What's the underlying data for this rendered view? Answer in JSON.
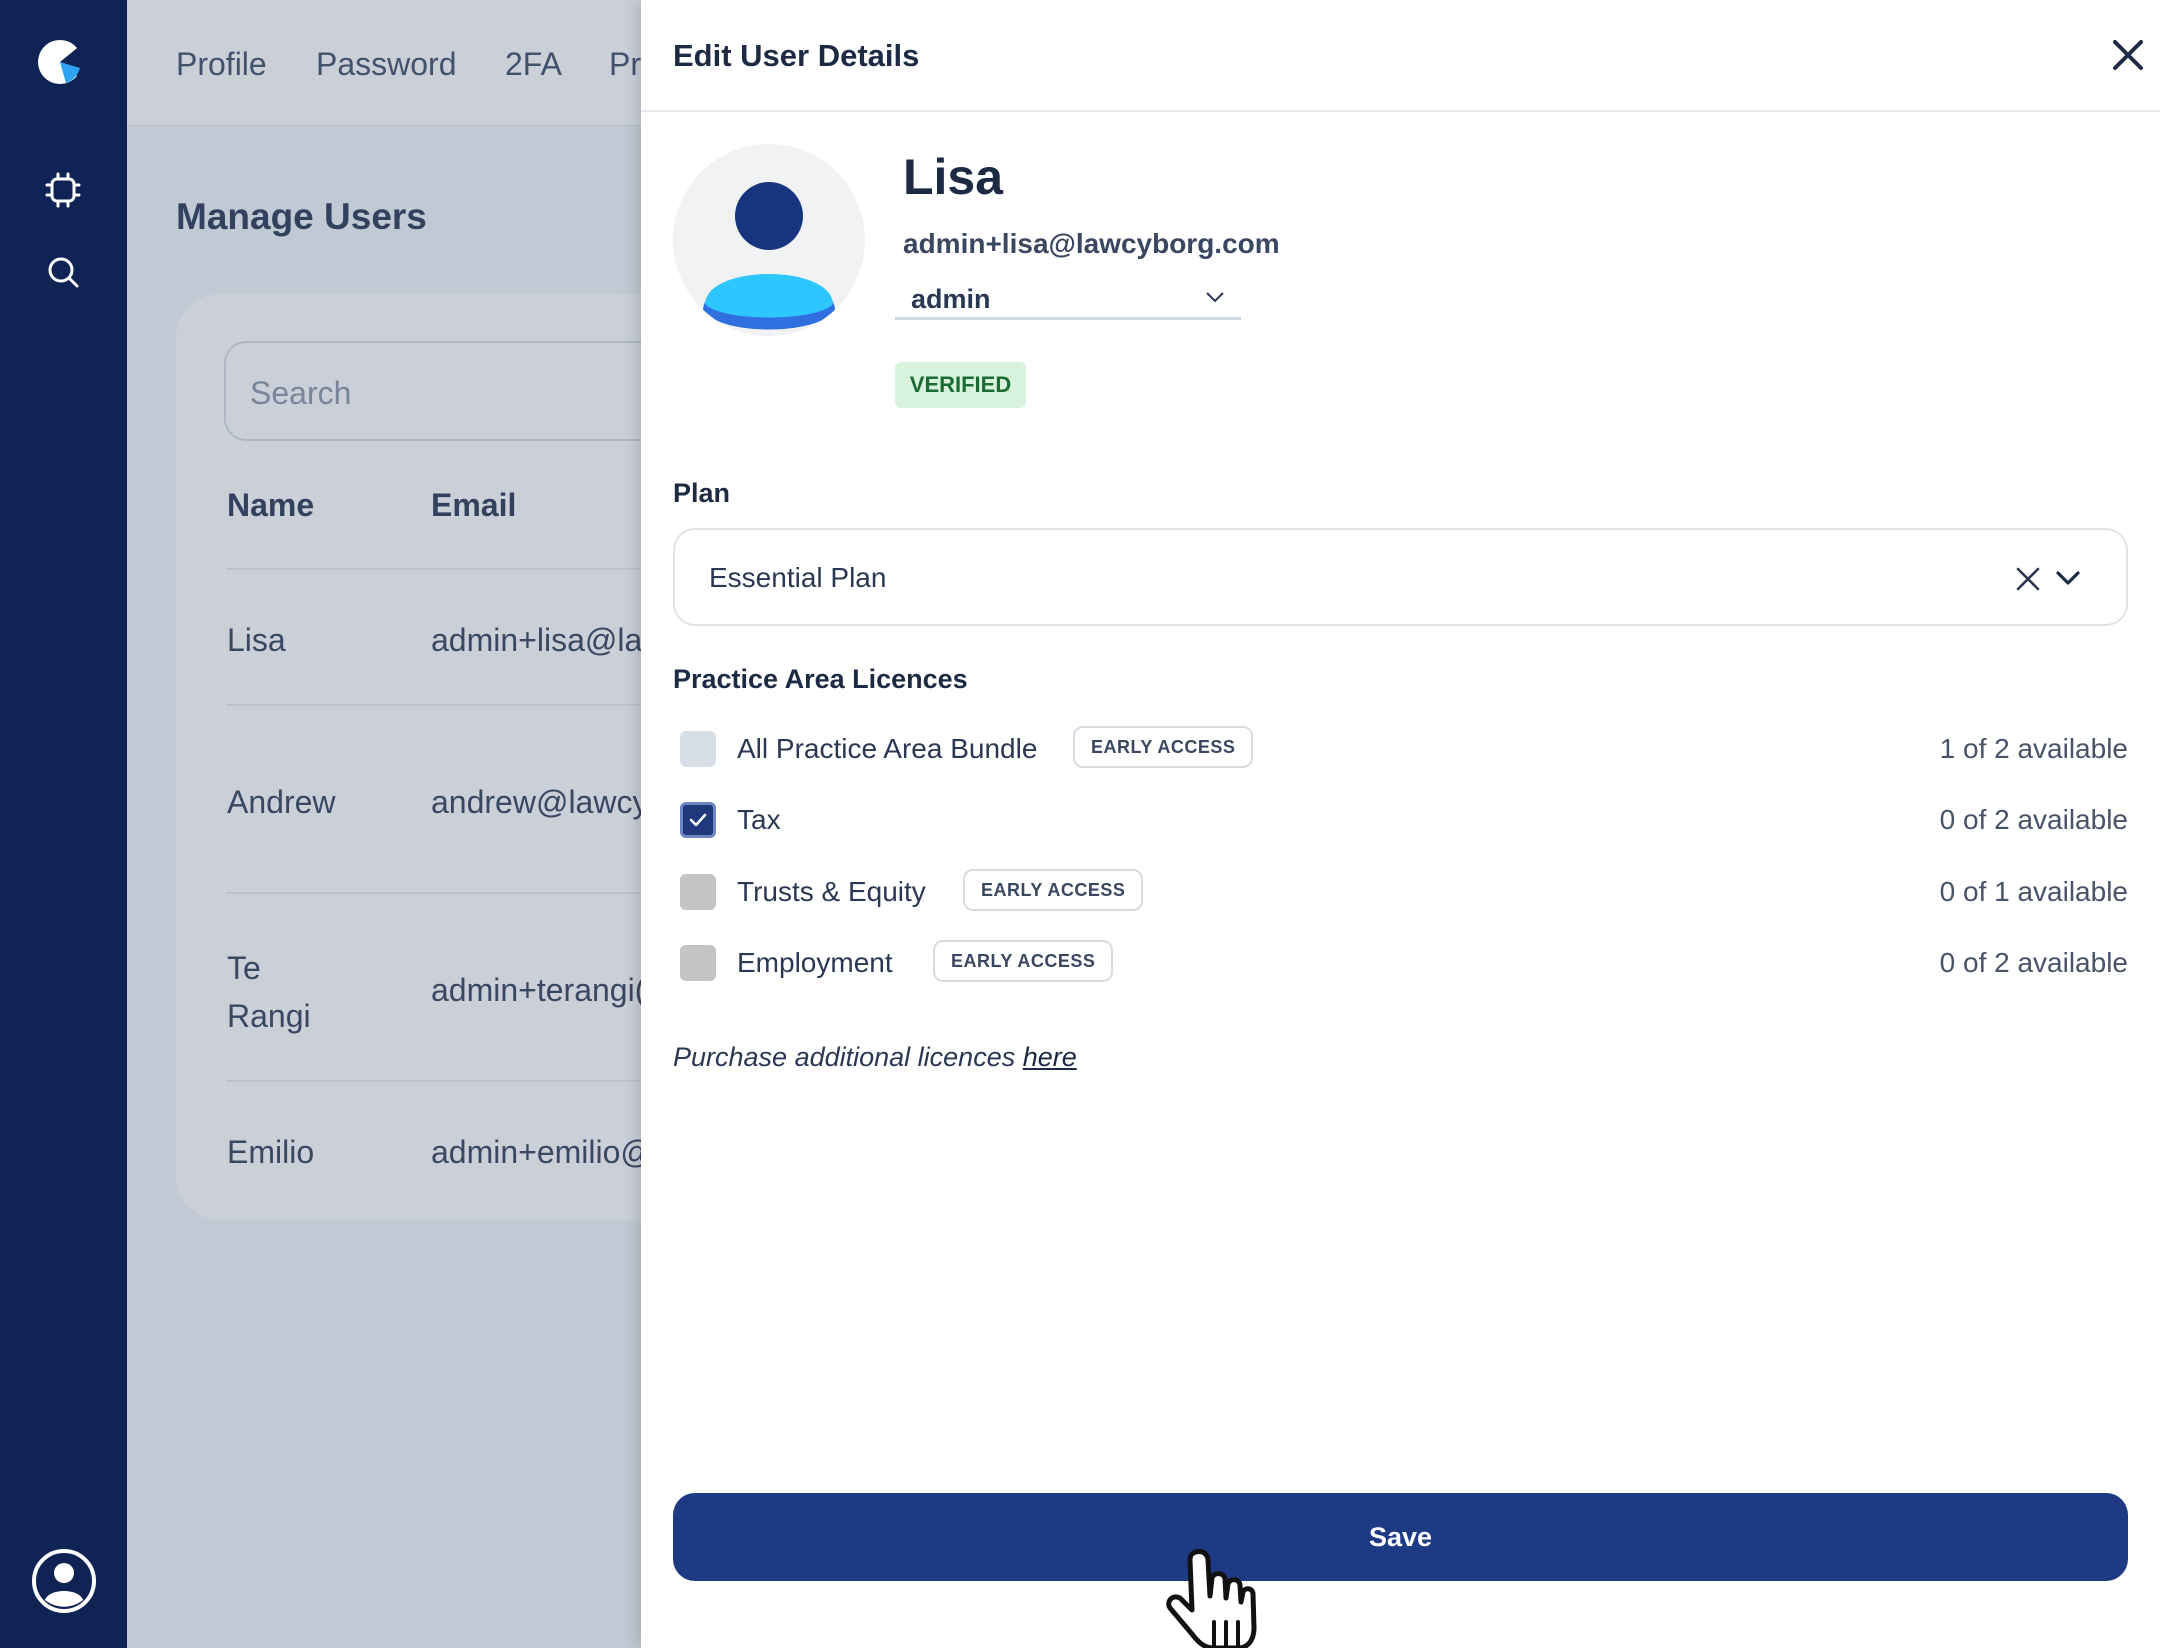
{
  "rail": {
    "icons": [
      "app-logo",
      "chip-icon",
      "search-icon",
      "account-icon"
    ],
    "colors": {
      "background": "#0f2454",
      "logo_accent": "#2ea3f2"
    }
  },
  "topnav": {
    "tabs": [
      "Profile",
      "Password",
      "2FA",
      "Pr"
    ]
  },
  "manage_users": {
    "title": "Manage Users",
    "search_placeholder": "Search",
    "columns": [
      "Name",
      "Email"
    ],
    "rows": [
      {
        "name": "Lisa",
        "email": "admin+lisa@la"
      },
      {
        "name": "Andrew",
        "email": "andrew@lawcy"
      },
      {
        "name": "Te Rangi",
        "email": "admin+terangi("
      },
      {
        "name": "Emilio",
        "email": "admin+emilio@"
      }
    ]
  },
  "drawer": {
    "title": "Edit User Details",
    "user": {
      "name": "Lisa",
      "email": "admin+lisa@lawcyborg.com",
      "role": "admin",
      "status": "VERIFIED"
    },
    "plan": {
      "label": "Plan",
      "value": "Essential Plan"
    },
    "licences": {
      "label": "Practice Area Licences",
      "items": [
        {
          "label": "All Practice Area Bundle",
          "badge": "EARLY ACCESS",
          "availability": "1 of 2 available",
          "checked": false
        },
        {
          "label": "Tax",
          "badge": "",
          "availability": "0 of 2 available",
          "checked": true
        },
        {
          "label": "Trusts & Equity",
          "badge": "EARLY ACCESS",
          "availability": "0 of 1 available",
          "checked": false
        },
        {
          "label": "Employment",
          "badge": "EARLY ACCESS",
          "availability": "0 of 2 available",
          "checked": false
        }
      ]
    },
    "purchase": {
      "text": "Purchase additional licences ",
      "link": "here"
    },
    "save_label": "Save"
  },
  "colors": {
    "primary": "#1f3a85",
    "verified_bg": "#d8f3dd",
    "verified_text": "#1d6b34"
  }
}
